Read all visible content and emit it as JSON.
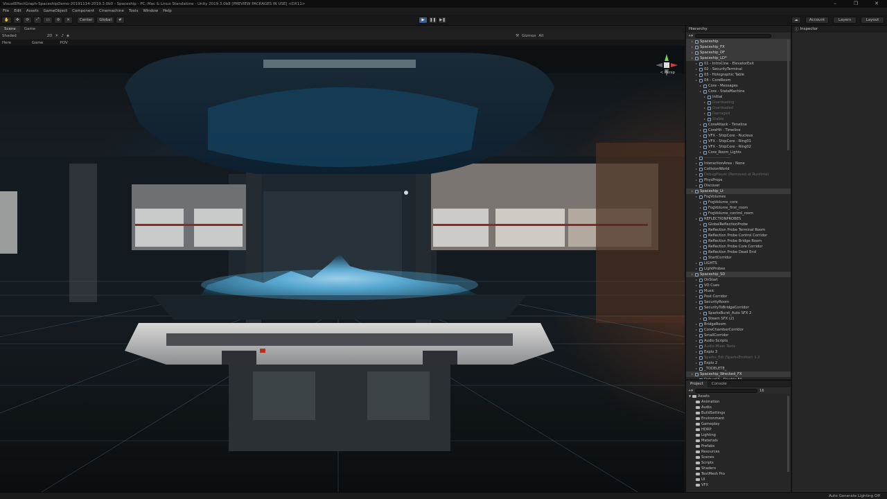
{
  "window": {
    "title": "VisualEffectGraph-SpaceshipDemo-20191114-2019.3.0b0 - Spaceship - PC, Mac & Linux Standalone - Unity 2019.3.0b8 [PREVIEW PACKAGES IN USE] <DX11>",
    "controls": [
      "–",
      "❐",
      "✕"
    ]
  },
  "menu": [
    "File",
    "Edit",
    "Assets",
    "GameObject",
    "Component",
    "Cinemachine",
    "Tools",
    "Window",
    "Help"
  ],
  "toolbar": {
    "pivot": "Center",
    "space": "Global",
    "account": "Account",
    "layers": "Layers",
    "layout": "Layout"
  },
  "scene_tabs": [
    "Scene",
    "Game"
  ],
  "scene_bar": {
    "shading": "Shaded",
    "mode": "2D",
    "gizmos": "Gizmos",
    "search": "All"
  },
  "view_bar": [
    "Here",
    "Game",
    "POV"
  ],
  "gizmo": {
    "label": "< Persp"
  },
  "hierarchy": {
    "tab": "Hierarchy",
    "rows": [
      {
        "text": "Spaceship",
        "indent": 1,
        "scene": true
      },
      {
        "text": "Spaceship_FX",
        "indent": 1,
        "scene": true
      },
      {
        "text": "Spaceship_DF",
        "indent": 1,
        "scene": true
      },
      {
        "text": "Spaceship_LD*",
        "indent": 1,
        "scene": true
      },
      {
        "text": "01 - IntroCine - ElevatorExit",
        "indent": 2
      },
      {
        "text": "02 - SecurityTerminal",
        "indent": 2
      },
      {
        "text": "03 - Holographic Table",
        "indent": 2
      },
      {
        "text": "04 - CoreRoom",
        "indent": 2
      },
      {
        "text": "Core - Messages",
        "indent": 3
      },
      {
        "text": "Core - StateMachine",
        "indent": 3
      },
      {
        "text": "Initial",
        "indent": 4
      },
      {
        "text": "Overloading",
        "indent": 4,
        "dim": true
      },
      {
        "text": "Overloaded",
        "indent": 4,
        "dim": true
      },
      {
        "text": "Damaged",
        "indent": 4,
        "dim": true
      },
      {
        "text": "Stable",
        "indent": 4,
        "dim": true
      },
      {
        "text": "CoreAttack - Timeline",
        "indent": 3
      },
      {
        "text": "CoreHit - Timeline",
        "indent": 3
      },
      {
        "text": "VFX - ShipCore - Nucleus",
        "indent": 3
      },
      {
        "text": "VFX - ShipCore - Ring01",
        "indent": 3
      },
      {
        "text": "VFX - ShipCore - Ring02",
        "indent": 3
      },
      {
        "text": "Core_Room_Lights",
        "indent": 3
      },
      {
        "text": "--------------------",
        "indent": 2,
        "dim": true
      },
      {
        "text": "InteractionArea : None",
        "indent": 2
      },
      {
        "text": "CollisionWorld",
        "indent": 2
      },
      {
        "text": "DebugPlayer (Removed at Runtime)",
        "indent": 2,
        "dim": true
      },
      {
        "text": "PhysProps",
        "indent": 2
      },
      {
        "text": "Discover",
        "indent": 2
      },
      {
        "text": "Spaceship_Lt",
        "indent": 1,
        "scene": true
      },
      {
        "text": "FogVolumes",
        "indent": 2
      },
      {
        "text": "FogVolume_core",
        "indent": 3
      },
      {
        "text": "FogVolume_first_room",
        "indent": 3
      },
      {
        "text": "FogVolume_control_room",
        "indent": 3
      },
      {
        "text": "REFLECTIONPROBES",
        "indent": 2
      },
      {
        "text": "GlobalReflectionProbe",
        "indent": 3
      },
      {
        "text": "Reflection Probe Terminal Room",
        "indent": 3
      },
      {
        "text": "Reflection Probe Control Corridor",
        "indent": 3
      },
      {
        "text": "Reflection Probe Bridge Room",
        "indent": 3
      },
      {
        "text": "Reflection Probe Core Corridor",
        "indent": 3
      },
      {
        "text": "Reflection Probe Dead End",
        "indent": 3
      },
      {
        "text": "StartCorridor",
        "indent": 3
      },
      {
        "text": "LIGHTS",
        "indent": 2
      },
      {
        "text": "LightProbes",
        "indent": 2
      },
      {
        "text": "Spaceship_SD",
        "indent": 1,
        "scene": true
      },
      {
        "text": "OnStart",
        "indent": 2
      },
      {
        "text": "VO Cues",
        "indent": 2
      },
      {
        "text": "Music",
        "indent": 2
      },
      {
        "text": "Post Corridor",
        "indent": 2
      },
      {
        "text": "SecurityRoom",
        "indent": 2
      },
      {
        "text": "SecurityToBridgeCorridor",
        "indent": 2
      },
      {
        "text": "SparksBurst_Auto SFX 2",
        "indent": 3
      },
      {
        "text": "Steam SFX (2)",
        "indent": 3
      },
      {
        "text": "BridgeRoom",
        "indent": 2
      },
      {
        "text": "CoreChamberCorridor",
        "indent": 2
      },
      {
        "text": "SmallCorridor",
        "indent": 2
      },
      {
        "text": "Audio Scripts",
        "indent": 2
      },
      {
        "text": "Audio Mixer Tests",
        "indent": 2,
        "dim": true
      },
      {
        "text": "Explo 3",
        "indent": 2
      },
      {
        "text": "Sparks_Edi (SparksEmitter) 1.2",
        "indent": 2,
        "dim": true
      },
      {
        "text": "Explo 2",
        "indent": 2
      },
      {
        "text": "_TODELETE_",
        "indent": 2
      },
      {
        "text": "Spaceship_Wrecked_FX",
        "indent": 1,
        "scene": true
      },
      {
        "text": "DebugUI - Disable FX",
        "indent": 2
      }
    ]
  },
  "inspector": {
    "tab": "Inspector"
  },
  "project": {
    "tabs": [
      "Project",
      "Console"
    ],
    "root": "Assets",
    "folders": [
      "Animation",
      "Audio",
      "BuildSettings",
      "Environment",
      "Gameplay",
      "HDRP",
      "Lighting",
      "Materials",
      "Prefabs",
      "Resources",
      "Scenes",
      "Scripts",
      "Shaders",
      "TextMesh Pro",
      "UI",
      "VFX"
    ],
    "count": "16"
  },
  "status": {
    "text": "Auto Generate Lighting Off"
  }
}
